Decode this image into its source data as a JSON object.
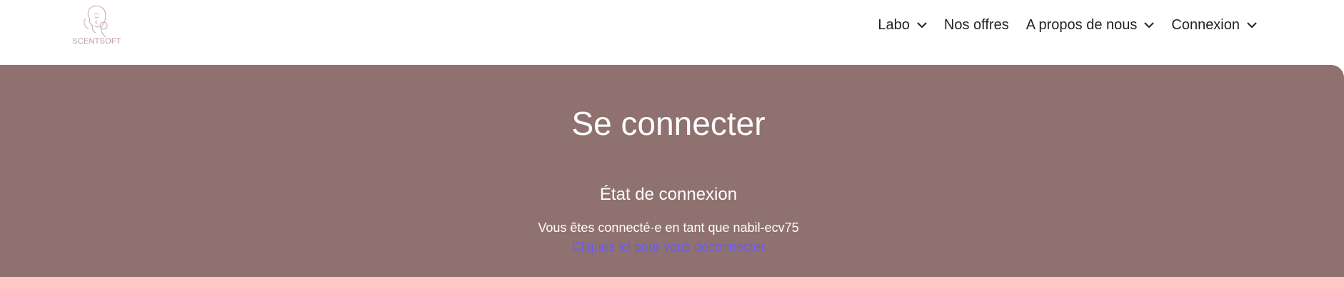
{
  "header": {
    "logo_text": "SCENTSOFT",
    "logo_icon": "face-line-art-icon",
    "nav": [
      {
        "label": "Labo",
        "has_dropdown": true
      },
      {
        "label": "Nos offres",
        "has_dropdown": false
      },
      {
        "label": "A propos de nous",
        "has_dropdown": true
      },
      {
        "label": "Connexion",
        "has_dropdown": true
      }
    ]
  },
  "main": {
    "title": "Se connecter",
    "state_heading": "État de connexion",
    "status_text": "Vous êtes connecté·e en tant que nabil-ecv75",
    "logout_link": "Cliquez ici pour vous déconnecter"
  },
  "colors": {
    "hero_background": "#8f716f",
    "link": "#6a5cf0",
    "footer_strip": "#ffc8c4",
    "logo": "#b89aa0"
  }
}
